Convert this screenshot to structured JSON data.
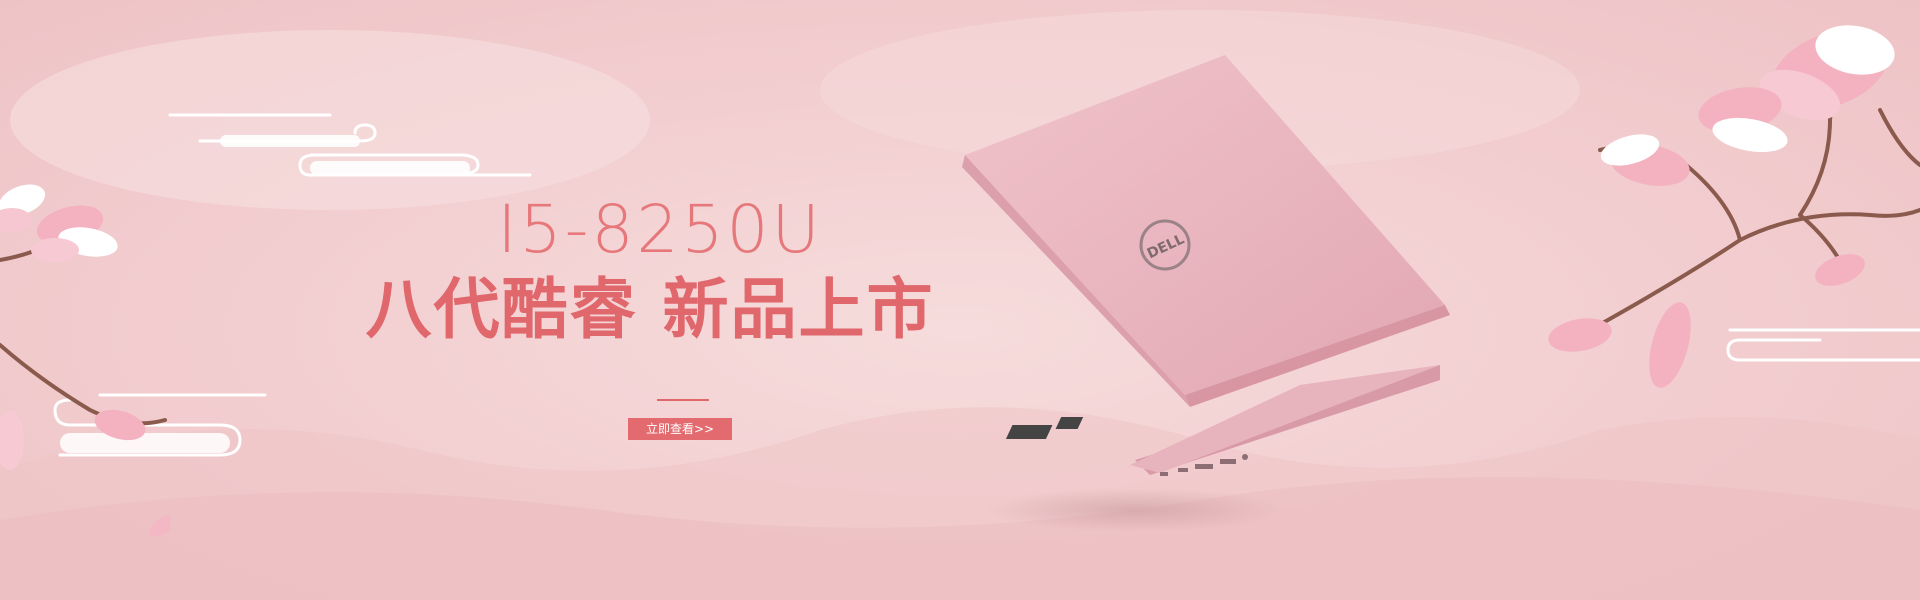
{
  "banner": {
    "model": "I5-8250U",
    "headline": "八代酷睿 新品上市",
    "cta_label": "立即查看>>",
    "laptop_logo": "DELL"
  },
  "colors": {
    "accent": "#e0676c",
    "accent_light": "#e6787b",
    "background": "#f2cdcf",
    "laptop_lid": "#e9b4bd",
    "petal": "#f4b8c4"
  },
  "icons": {
    "brand_logo": "dell-logo-icon",
    "flowers": "magnolia-branch-icon",
    "clouds": "cloud-swirl-icon"
  }
}
